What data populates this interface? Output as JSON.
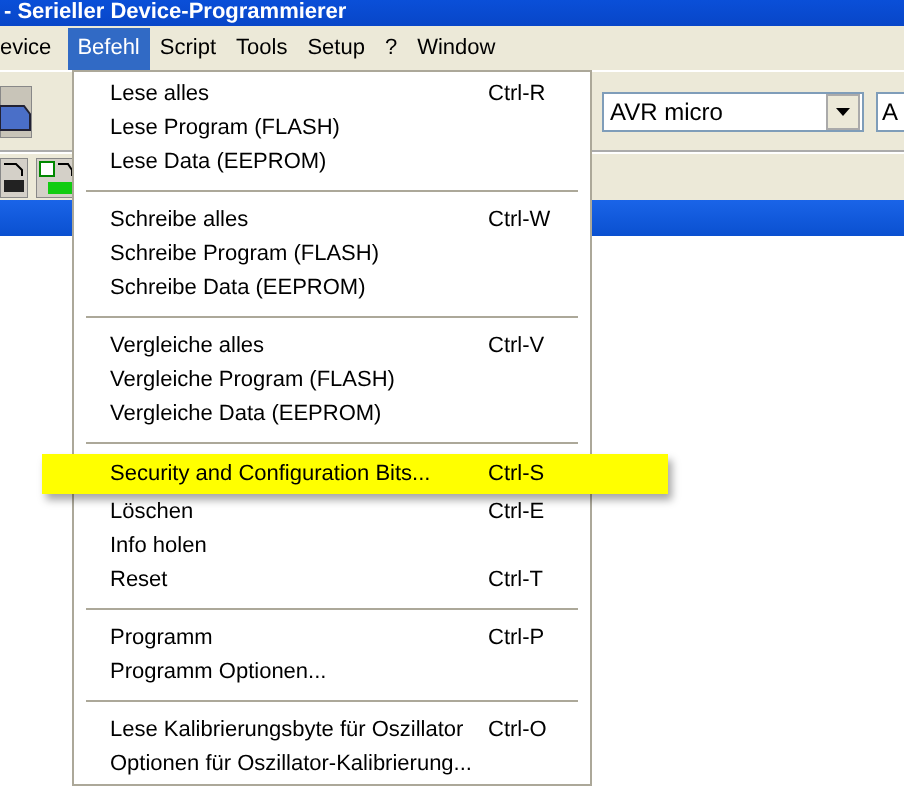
{
  "window": {
    "title": "- Serieller Device-Programmierer"
  },
  "menubar": [
    {
      "label": "evice",
      "selected": false
    },
    {
      "label": "Befehl",
      "selected": true
    },
    {
      "label": "Script",
      "selected": false
    },
    {
      "label": "Tools",
      "selected": false
    },
    {
      "label": "Setup",
      "selected": false
    },
    {
      "label": "?",
      "selected": false
    },
    {
      "label": "Window",
      "selected": false
    }
  ],
  "toolbar": {
    "device_family": "AVR micro",
    "device": "A"
  },
  "menu": [
    {
      "kind": "item",
      "label": "Lese alles",
      "shortcut": "Ctrl-R",
      "selected": false
    },
    {
      "kind": "item",
      "label": "Lese Program (FLASH)",
      "selected": false
    },
    {
      "kind": "item",
      "label": "Lese Data (EEPROM)",
      "selected": false
    },
    {
      "kind": "separator"
    },
    {
      "kind": "item",
      "label": "Schreibe alles",
      "shortcut": "Ctrl-W",
      "selected": false
    },
    {
      "kind": "item",
      "label": "Schreibe Program (FLASH)",
      "selected": false
    },
    {
      "kind": "item",
      "label": "Schreibe Data (EEPROM)",
      "selected": false
    },
    {
      "kind": "separator"
    },
    {
      "kind": "item",
      "label": "Vergleiche alles",
      "shortcut": "Ctrl-V",
      "selected": false
    },
    {
      "kind": "item",
      "label": "Vergleiche Program (FLASH)",
      "selected": false
    },
    {
      "kind": "item",
      "label": "Vergleiche Data (EEPROM)",
      "selected": false
    },
    {
      "kind": "separator"
    },
    {
      "kind": "item",
      "label": "Security and Configuration Bits...",
      "shortcut": "Ctrl-S",
      "selected": true
    },
    {
      "kind": "item",
      "label": "Löschen",
      "shortcut": "Ctrl-E",
      "selected": false
    },
    {
      "kind": "item",
      "label": "Info holen",
      "selected": false
    },
    {
      "kind": "item",
      "label": "Reset",
      "shortcut": "Ctrl-T",
      "selected": false
    },
    {
      "kind": "separator"
    },
    {
      "kind": "item",
      "label": "Programm",
      "shortcut": "Ctrl-P",
      "selected": false
    },
    {
      "kind": "item",
      "label": "Programm Optionen...",
      "selected": false
    },
    {
      "kind": "separator"
    },
    {
      "kind": "item",
      "label": "Lese Kalibrierungsbyte für Oszillator",
      "shortcut": "Ctrl-O",
      "selected": false
    },
    {
      "kind": "item",
      "label": "Optionen für Oszillator-Kalibrierung...",
      "selected": false
    }
  ]
}
